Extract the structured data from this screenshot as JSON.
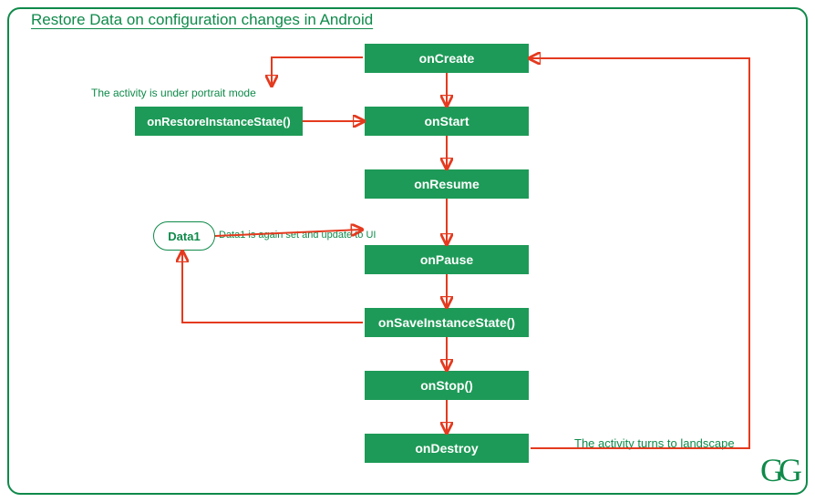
{
  "title": "Restore Data on configuration changes in Android",
  "nodes": {
    "oncreate": "onCreate",
    "onstart": "onStart",
    "onresume": "onResume",
    "onpause": "onPause",
    "onsave": "onSaveInstanceState()",
    "onstop": "onStop()",
    "ondestroy": "onDestroy",
    "onrestore": "onRestoreInstanceState()"
  },
  "data_node": "Data1",
  "labels": {
    "portrait": "The activity is under portrait mode",
    "data_update": "Data1 is again set and update to UI",
    "landscape": "The activity turns to landscape"
  },
  "logo": "GG"
}
